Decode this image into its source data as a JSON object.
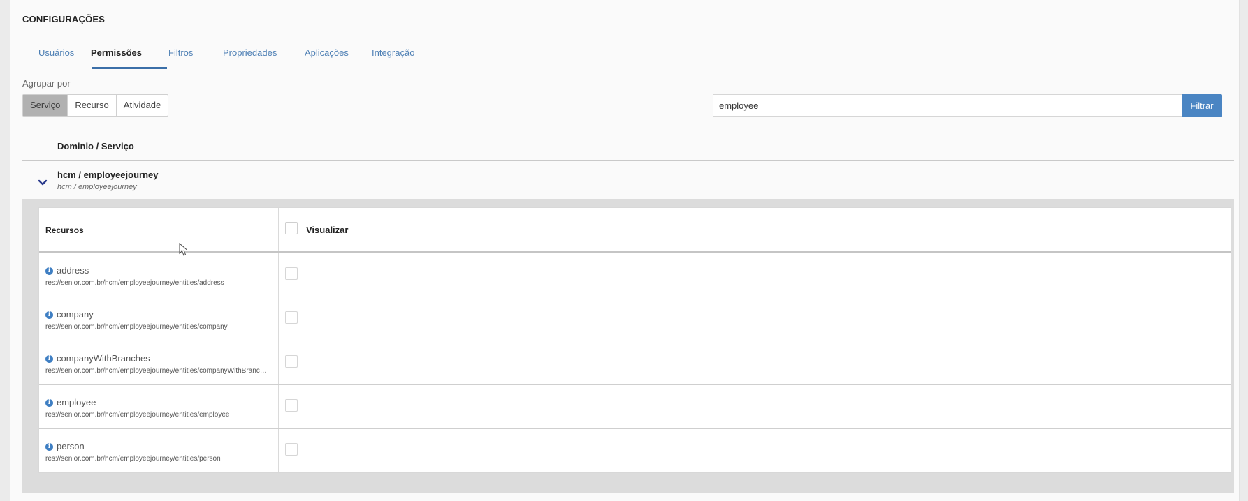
{
  "page": {
    "title": "CONFIGURAÇÕES"
  },
  "tabs": [
    {
      "label": "Usuários",
      "active": false
    },
    {
      "label": "Permissões",
      "active": true
    },
    {
      "label": "Filtros",
      "active": false
    },
    {
      "label": "Propriedades",
      "active": false
    },
    {
      "label": "Aplicações",
      "active": false
    },
    {
      "label": "Integração",
      "active": false
    }
  ],
  "group_by": {
    "label": "Agrupar por",
    "options": [
      "Serviço",
      "Recurso",
      "Atividade"
    ],
    "selected": "Serviço"
  },
  "search": {
    "value": "employee",
    "button_label": "Filtrar"
  },
  "list": {
    "column_header": "Dominio / Serviço",
    "domain": {
      "title": "hcm / employeejourney",
      "subtitle": "hcm / employeejourney",
      "icon": "chevron-down-icon",
      "expanded": true
    }
  },
  "resources_table": {
    "col_resources": "Recursos",
    "col_view": "Visualizar",
    "rows": [
      {
        "name": "address",
        "path": "res://senior.com.br/hcm/employeejourney/entities/address",
        "checked": false
      },
      {
        "name": "company",
        "path": "res://senior.com.br/hcm/employeejourney/entities/company",
        "checked": false
      },
      {
        "name": "companyWithBranches",
        "path": "res://senior.com.br/hcm/employeejourney/entities/companyWithBranches",
        "checked": false
      },
      {
        "name": "employee",
        "path": "res://senior.com.br/hcm/employeejourney/entities/employee",
        "checked": false
      },
      {
        "name": "person",
        "path": "res://senior.com.br/hcm/employeejourney/entities/person",
        "checked": false
      }
    ]
  },
  "colors": {
    "accent": "#4a85c3",
    "tab_link": "#4d7fb4",
    "active_segment": "#b1b1b1",
    "chevron": "#2a3a8c"
  }
}
